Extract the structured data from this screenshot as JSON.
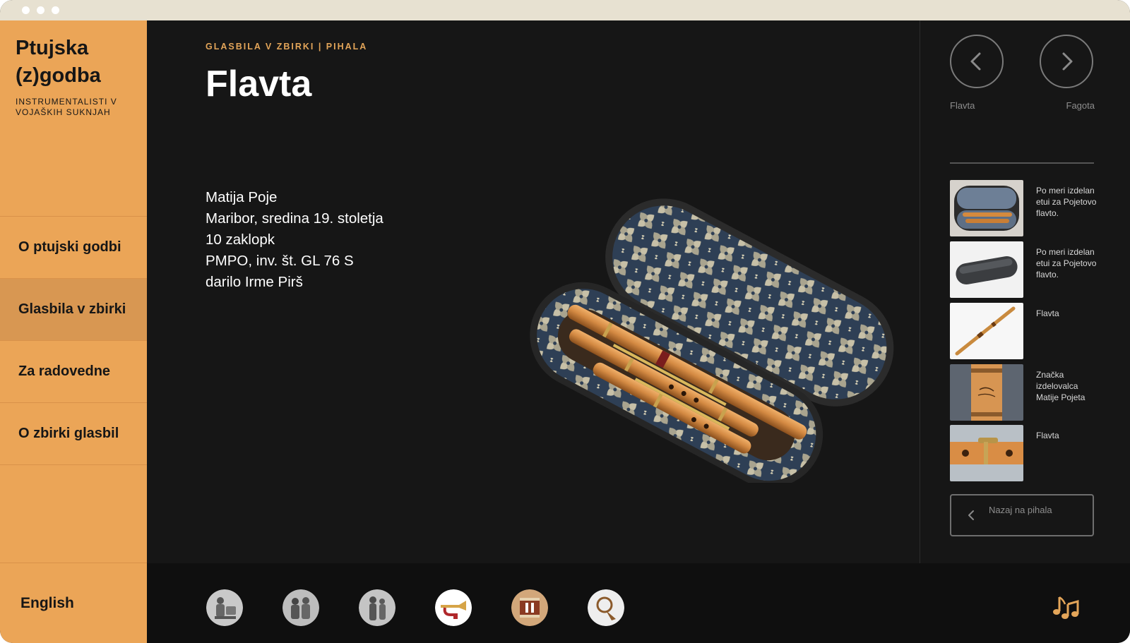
{
  "brand": {
    "title": "Ptujska (z)godba",
    "subtitle": "INSTRUMENTALISTI V VOJAŠKIH SUKNJAH"
  },
  "nav": {
    "items": [
      {
        "label": "O ptujski godbi",
        "active": false
      },
      {
        "label": "Glasbila v zbirki",
        "active": true
      },
      {
        "label": "Za radovedne",
        "active": false
      },
      {
        "label": "O zbirki glasbil",
        "active": false
      }
    ],
    "language": "English"
  },
  "main": {
    "breadcrumb": "GLASBILA V ZBIRKI | PIHALA",
    "title": "Flavta",
    "details": [
      "Matija Poje",
      "Maribor, sredina 19. stoletja",
      "10 zaklopk",
      "PMPO, inv. št. GL 76 S",
      "darilo Irme Pirš"
    ]
  },
  "pager": {
    "prev_label": "Flavta",
    "next_label": "Fagota"
  },
  "gallery": [
    {
      "caption": "Po meri izdelan etui za Pojetovo flavto."
    },
    {
      "caption": "Po meri izdelan etui za Pojetovo flavto."
    },
    {
      "caption": "Flavta"
    },
    {
      "caption": "Značka izdelovalca Matije Pojeta"
    },
    {
      "caption": "Flavta"
    }
  ],
  "back_button": {
    "label": "Nazaj na pihala"
  },
  "colors": {
    "accent": "#eba557",
    "accent_active": "#d89752",
    "background": "#161616",
    "bottom_bar": "#0f0f0f",
    "breadcrumb": "#e3a559"
  },
  "icons": {
    "prev": "chevron-left-icon",
    "next": "chevron-right-icon",
    "back": "chevron-left-icon",
    "music": "music-notes-icon"
  }
}
